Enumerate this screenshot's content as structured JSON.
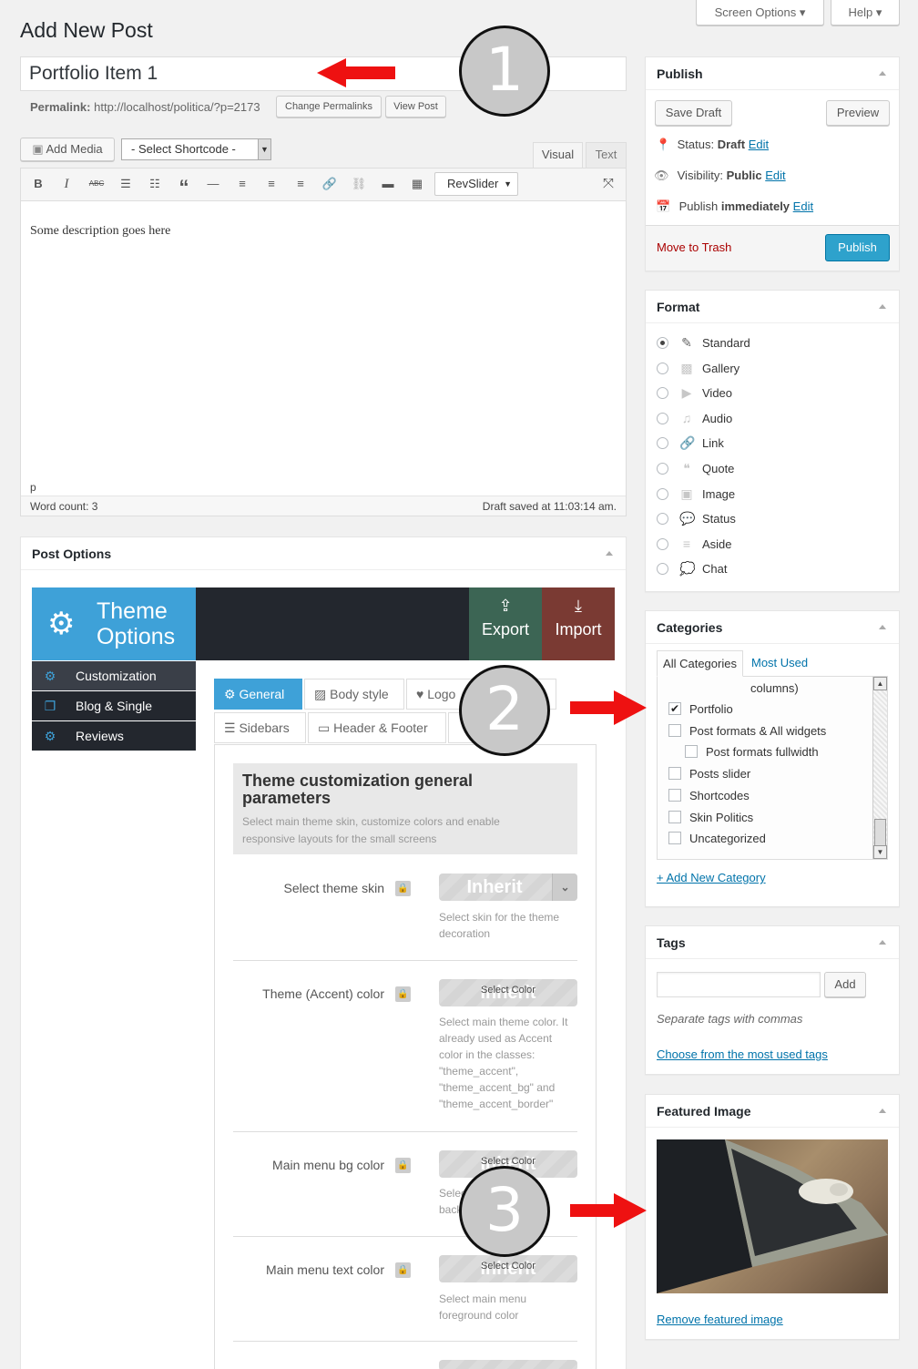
{
  "screen": {
    "screen_options_label": "Screen Options",
    "help_label": "Help",
    "page_title": "Add New Post"
  },
  "post": {
    "title_value": "Portfolio Item 1",
    "permalink_label": "Permalink:",
    "permalink_url": "http://localhost/politica/?p=2173",
    "change_permalinks_label": "Change Permalinks",
    "view_post_label": "View Post"
  },
  "editor": {
    "add_media_label": "Add Media",
    "shortcode_select": "- Select Shortcode -",
    "tab_visual": "Visual",
    "tab_text": "Text",
    "revslider_label": "RevSlider",
    "content": "Some description goes here",
    "path": "p",
    "word_count": "Word count: 3",
    "draft_saved": "Draft saved at 11:03:14 am."
  },
  "post_options": {
    "title": "Post Options",
    "theme_title_line1": "Theme",
    "theme_title_line2": "Options",
    "export_label": "Export",
    "import_label": "Import",
    "colors": {
      "header_blue": "#3ea1d8",
      "dark": "#23272e",
      "export_green": "#3c6554",
      "import_red": "#7a3a33"
    },
    "nav_items": [
      {
        "label": "Customization",
        "icon": "gears-icon"
      },
      {
        "label": "Blog & Single",
        "icon": "copy-icon"
      },
      {
        "label": "Reviews",
        "icon": "gear-icon"
      }
    ],
    "tabs": [
      "General",
      "Body style",
      "Logo",
      "Sidebars",
      "Header & Footer"
    ],
    "section_title": "Theme customization general parameters",
    "section_desc": "Select main theme skin, customize colors and enable responsive layouts for the small screens",
    "fields": [
      {
        "label": "Select theme skin",
        "value": "Inherit",
        "desc": "Select skin for the theme decoration"
      },
      {
        "label": "Theme (Accent) color",
        "value": "Inherit",
        "button": "Select Color",
        "desc": "Select main theme color. It already used as Accent color in the classes: \"theme_accent\", \"theme_accent_bg\" and \"theme_accent_border\""
      },
      {
        "label": "Main menu bg color",
        "value": "Inherit",
        "button": "Select Color",
        "desc": "Select main menu background color"
      },
      {
        "label": "Main menu text color",
        "value": "Inherit",
        "button": "Select Color",
        "desc": "Select main menu foreground color"
      }
    ]
  },
  "publish": {
    "title": "Publish",
    "save_draft_label": "Save Draft",
    "preview_label": "Preview",
    "status_label": "Status:",
    "status_value": "Draft",
    "visibility_label": "Visibility:",
    "visibility_value": "Public",
    "publish_label": "Publish",
    "publish_when": "immediately",
    "edit_label": "Edit",
    "trash_label": "Move to Trash",
    "publish_button": "Publish"
  },
  "format": {
    "title": "Format",
    "options": [
      {
        "label": "Standard",
        "icon": "pin-icon",
        "selected": true
      },
      {
        "label": "Gallery",
        "icon": "gallery-icon",
        "selected": false
      },
      {
        "label": "Video",
        "icon": "video-icon",
        "selected": false
      },
      {
        "label": "Audio",
        "icon": "audio-icon",
        "selected": false
      },
      {
        "label": "Link",
        "icon": "link-icon",
        "selected": false
      },
      {
        "label": "Quote",
        "icon": "quote-icon",
        "selected": false
      },
      {
        "label": "Image",
        "icon": "image-icon",
        "selected": false
      },
      {
        "label": "Status",
        "icon": "status-icon",
        "selected": false
      },
      {
        "label": "Aside",
        "icon": "aside-icon",
        "selected": false
      },
      {
        "label": "Chat",
        "icon": "chat-icon",
        "selected": false
      }
    ]
  },
  "categories": {
    "title": "Categories",
    "tab_all": "All Categories",
    "tab_most_used": "Most Used",
    "partial_item": "columns)",
    "items": [
      {
        "label": "Portfolio",
        "checked": true,
        "indent": 0
      },
      {
        "label": "Post formats & All widgets",
        "checked": false,
        "indent": 0
      },
      {
        "label": "Post formats fullwidth",
        "checked": false,
        "indent": 1
      },
      {
        "label": "Posts slider",
        "checked": false,
        "indent": 0
      },
      {
        "label": "Shortcodes",
        "checked": false,
        "indent": 0
      },
      {
        "label": "Skin Politics",
        "checked": false,
        "indent": 0
      },
      {
        "label": "Uncategorized",
        "checked": false,
        "indent": 0
      }
    ],
    "add_new_label": "+ Add New Category"
  },
  "tags": {
    "title": "Tags",
    "add_label": "Add",
    "hint": "Separate tags with commas",
    "choose_label": "Choose from the most used tags"
  },
  "featured": {
    "title": "Featured Image",
    "remove_label": "Remove featured image"
  },
  "callouts": {
    "one": "1",
    "two": "2",
    "three": "3",
    "arrow_color": "#ee1111"
  }
}
